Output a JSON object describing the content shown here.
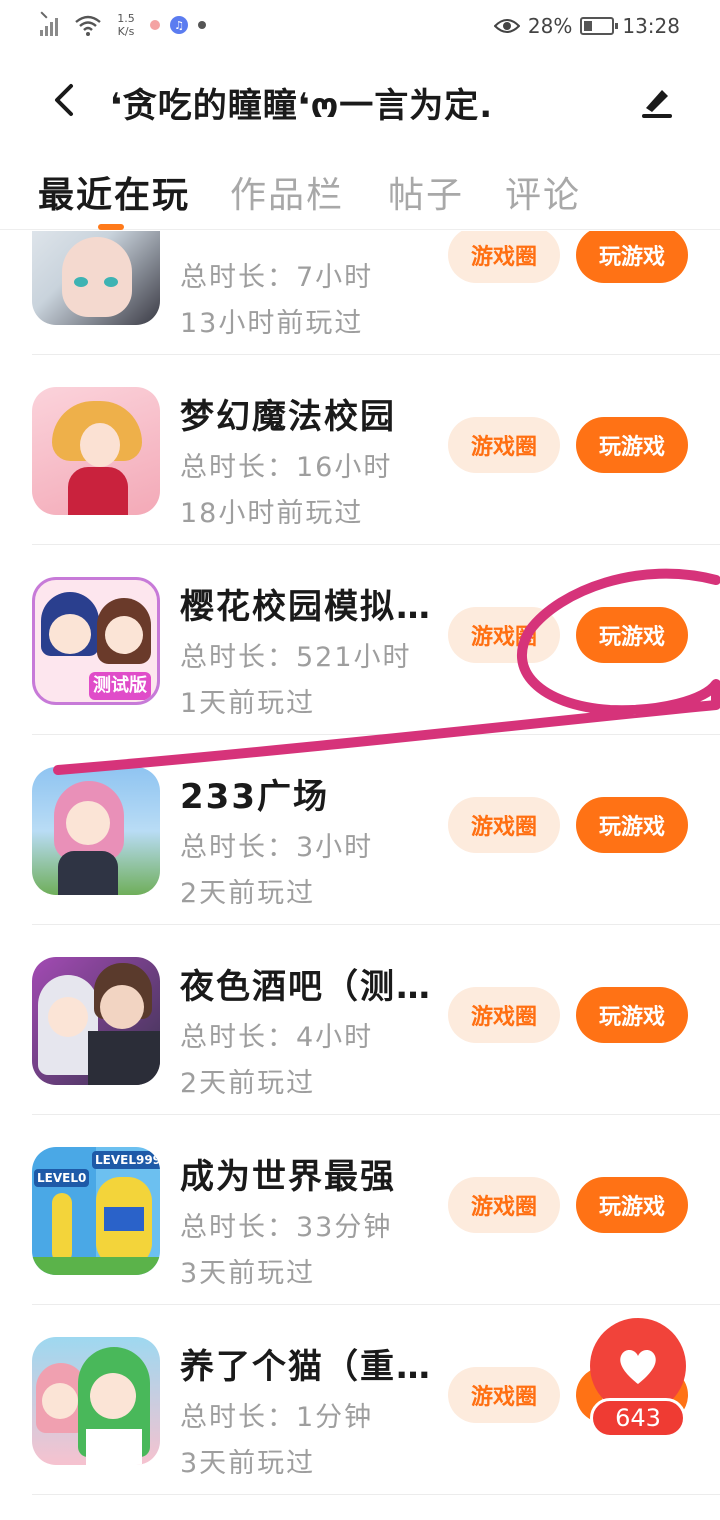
{
  "status_bar": {
    "network_speed": "1.5\nK/s",
    "battery": "28%",
    "time": "13:28",
    "icons": [
      "signal-icon",
      "wifi-icon",
      "notification-dot-icon",
      "music-icon",
      "dot-icon",
      "eye-icon",
      "battery-icon"
    ]
  },
  "header": {
    "title": "❛贪吃的瞳瞳❛ო一言为定.",
    "back_icon": "back-arrow-icon",
    "edit_icon": "pen-icon"
  },
  "tabs": [
    {
      "label": "最近在玩",
      "active": true
    },
    {
      "label": "作品栏",
      "active": false
    },
    {
      "label": "帖子",
      "active": false
    },
    {
      "label": "评论",
      "active": false
    }
  ],
  "games": [
    {
      "name": "",
      "duration": "总时长：7小时",
      "last_played": "13小时前玩过",
      "circle_label": "游戏圈",
      "play_label": "玩游戏",
      "colors": [
        "#3a3a44",
        "#c9d3dc"
      ]
    },
    {
      "name": "梦幻魔法校园",
      "duration": "总时长：16小时",
      "last_played": "18小时前玩过",
      "circle_label": "游戏圈",
      "play_label": "玩游戏",
      "colors": [
        "#f6b9c4",
        "#e9a04a"
      ]
    },
    {
      "name": "樱花校园模拟…",
      "duration": "总时长：521小时",
      "last_played": "1天前玩过",
      "circle_label": "游戏圈",
      "play_label": "玩游戏",
      "colors": [
        "#7b4fd8",
        "#f2c6d4"
      ],
      "icon_badge": "测试版"
    },
    {
      "name": "233广场",
      "duration": "总时长：3小时",
      "last_played": "2天前玩过",
      "circle_label": "游戏圈",
      "play_label": "玩游戏",
      "colors": [
        "#8fc4f1",
        "#e990b8"
      ]
    },
    {
      "name": "夜色酒吧（测…",
      "duration": "总时长：4小时",
      "last_played": "2天前玩过",
      "circle_label": "游戏圈",
      "play_label": "玩游戏",
      "colors": [
        "#7c2e8c",
        "#3a3350"
      ]
    },
    {
      "name": "成为世界最强",
      "duration": "总时长：33分钟",
      "last_played": "3天前玩过",
      "circle_label": "游戏圈",
      "play_label": "玩游戏",
      "colors": [
        "#4aa8e6",
        "#f3d43a"
      ],
      "icon_badges": [
        "LEVEL0",
        "LEVEL999"
      ]
    },
    {
      "name": "养了个猫（重…",
      "duration": "总时长：1分钟",
      "last_played": "3天前玩过",
      "circle_label": "游戏圈",
      "play_label": "玩游戏",
      "colors": [
        "#9ed8f0",
        "#49b85a"
      ]
    }
  ],
  "like_button": {
    "count": "643",
    "icon": "heart-icon"
  },
  "annotation_color": "#d6337a",
  "accent_color": "#ff7215"
}
